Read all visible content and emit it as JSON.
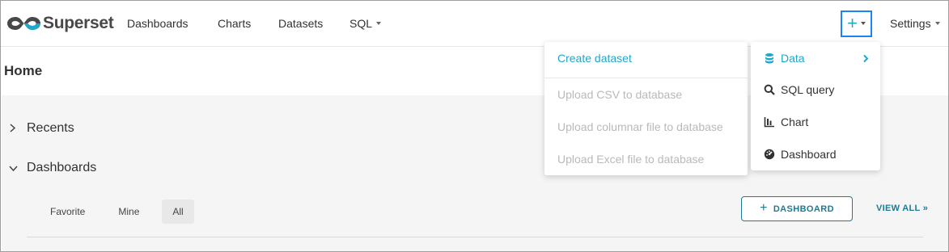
{
  "brand": {
    "name": "Superset"
  },
  "nav": {
    "items": [
      {
        "label": "Dashboards"
      },
      {
        "label": "Charts"
      },
      {
        "label": "Datasets"
      },
      {
        "label": "SQL"
      }
    ],
    "settings": "Settings",
    "new_button_glyph": "+"
  },
  "page": {
    "title": "Home"
  },
  "sections": {
    "recents": "Recents",
    "dashboards": "Dashboards"
  },
  "dashboard_tabs": [
    {
      "label": "Favorite"
    },
    {
      "label": "Mine"
    },
    {
      "label": "All",
      "active": true
    }
  ],
  "actions": {
    "add_dashboard": "DASHBOARD",
    "view_all": "VIEW ALL »"
  },
  "new_menu": {
    "items": [
      {
        "label": "Data",
        "icon": "database-icon",
        "active": true
      },
      {
        "label": "SQL query",
        "icon": "search-icon"
      },
      {
        "label": "Chart",
        "icon": "bar-chart-icon"
      },
      {
        "label": "Dashboard",
        "icon": "dashboard-icon"
      }
    ]
  },
  "data_submenu": {
    "items": [
      {
        "label": "Create dataset",
        "state": "active"
      },
      {
        "label": "Upload CSV to database",
        "state": "disabled"
      },
      {
        "label": "Upload columnar file to database",
        "state": "disabled"
      },
      {
        "label": "Upload Excel file to database",
        "state": "disabled"
      }
    ]
  },
  "colors": {
    "accent": "#20a7c9",
    "primary_dark": "#1f7a93",
    "focus_border": "#1a85f0",
    "disabled_text": "#b9b9b9",
    "content_bg": "#f5f5f5"
  }
}
